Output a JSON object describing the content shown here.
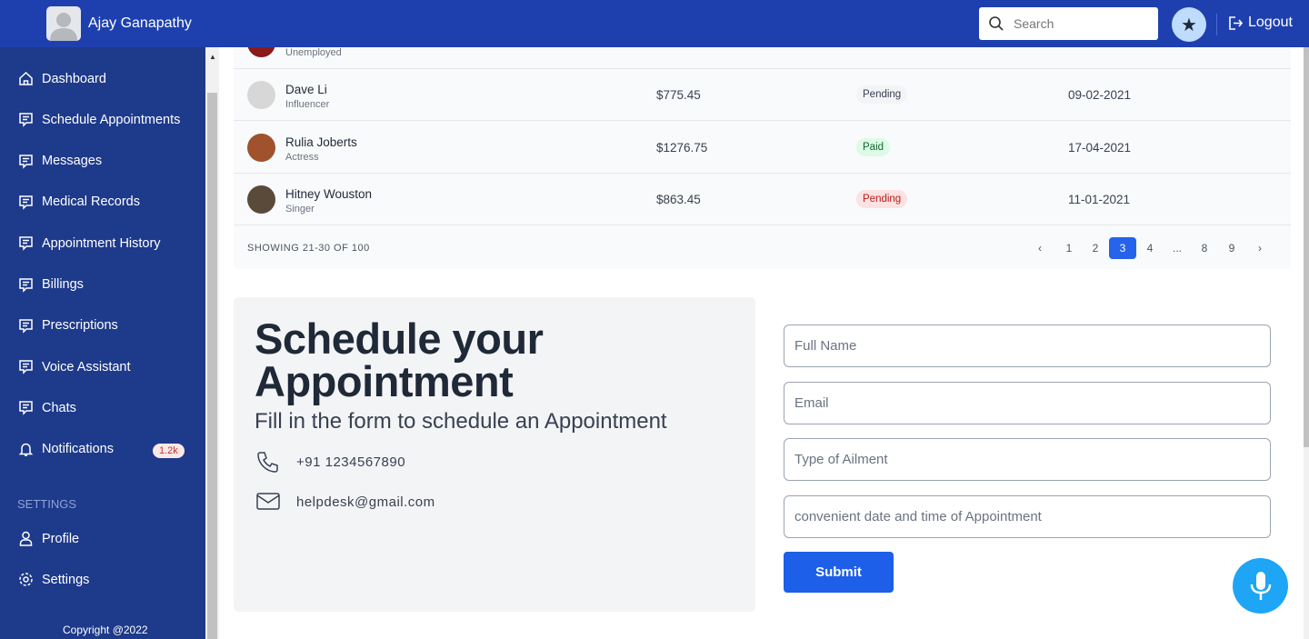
{
  "header": {
    "user_name": "Ajay Ganapathy",
    "search_placeholder": "Search",
    "logout_label": "Logout",
    "accent": "#1e40af"
  },
  "sidebar": {
    "items": [
      {
        "label": "Dashboard",
        "icon": "home-icon"
      },
      {
        "label": "Schedule Appointments",
        "icon": "message-icon"
      },
      {
        "label": "Messages",
        "icon": "message-icon"
      },
      {
        "label": "Medical Records",
        "icon": "message-icon"
      },
      {
        "label": "Appointment History",
        "icon": "message-icon"
      },
      {
        "label": "Billings",
        "icon": "message-icon"
      },
      {
        "label": "Prescriptions",
        "icon": "message-icon"
      },
      {
        "label": "Voice Assistant",
        "icon": "message-icon"
      },
      {
        "label": "Chats",
        "icon": "message-icon"
      },
      {
        "label": "Notifications",
        "icon": "bell-icon",
        "badge": "1.2k"
      }
    ],
    "settings_heading": "SETTINGS",
    "settings_items": [
      {
        "label": "Profile",
        "icon": "user-icon"
      },
      {
        "label": "Settings",
        "icon": "gear-icon"
      }
    ],
    "copyright": "Copyright @2022"
  },
  "table": {
    "rows": [
      {
        "name": "",
        "role": "Unemployed",
        "amount": "",
        "status": "",
        "date": ""
      },
      {
        "name": "Dave Li",
        "role": "Influencer",
        "amount": "$775.45",
        "status": "Pending",
        "date": "09-02-2021"
      },
      {
        "name": "Rulia Joberts",
        "role": "Actress",
        "amount": "$1276.75",
        "status": "Paid",
        "date": "17-04-2021"
      },
      {
        "name": "Hitney Wouston",
        "role": "Singer",
        "amount": "$863.45",
        "status": "Pending",
        "date": "11-01-2021"
      }
    ],
    "showing": "SHOWING 21-30 OF 100",
    "pages": [
      "1",
      "2",
      "3",
      "4",
      "...",
      "8",
      "9"
    ],
    "current_page": "3"
  },
  "appointment": {
    "title_line1": "Schedule your",
    "title_line2": "Appointment",
    "subtitle": "Fill in the form to schedule an Appointment",
    "phone": "+91 1234567890",
    "email": "helpdesk@gmail.com",
    "fields": {
      "full_name": "Full Name",
      "email": "Email",
      "ailment": "Type of Ailment",
      "datetime": "convenient date and time of Appointment"
    },
    "submit_label": "Submit"
  }
}
